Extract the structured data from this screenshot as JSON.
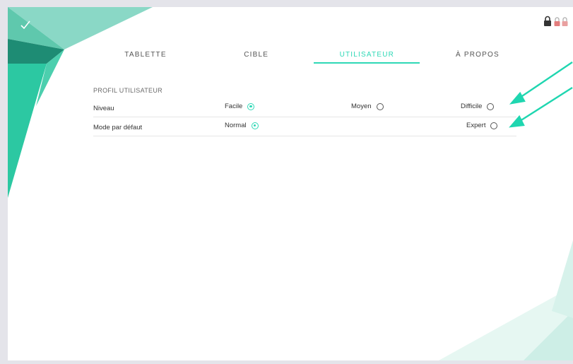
{
  "tabs": [
    {
      "label": "TABLETTE",
      "active": false
    },
    {
      "label": "CIBLE",
      "active": false
    },
    {
      "label": "UTILISATEUR",
      "active": true
    },
    {
      "label": "À PROPOS",
      "active": false
    }
  ],
  "section_title": "PROFIL UTILISATEUR",
  "rows": [
    {
      "label": "Niveau",
      "options": [
        {
          "label": "Facile",
          "selected": true
        },
        {
          "label": "Moyen",
          "selected": false
        },
        {
          "label": "Difficile",
          "selected": false
        }
      ]
    },
    {
      "label": "Mode par défaut",
      "options": [
        {
          "label": "Normal",
          "selected": true
        },
        {
          "label": "Expert",
          "selected": false
        }
      ]
    }
  ],
  "icons": {
    "confirm": "check-icon",
    "lock": "lock-icon",
    "status": "dual-lock-status-icon"
  },
  "colors": {
    "accent": "#2ed8b6",
    "annotation_arrow": "#1fd6b0"
  }
}
